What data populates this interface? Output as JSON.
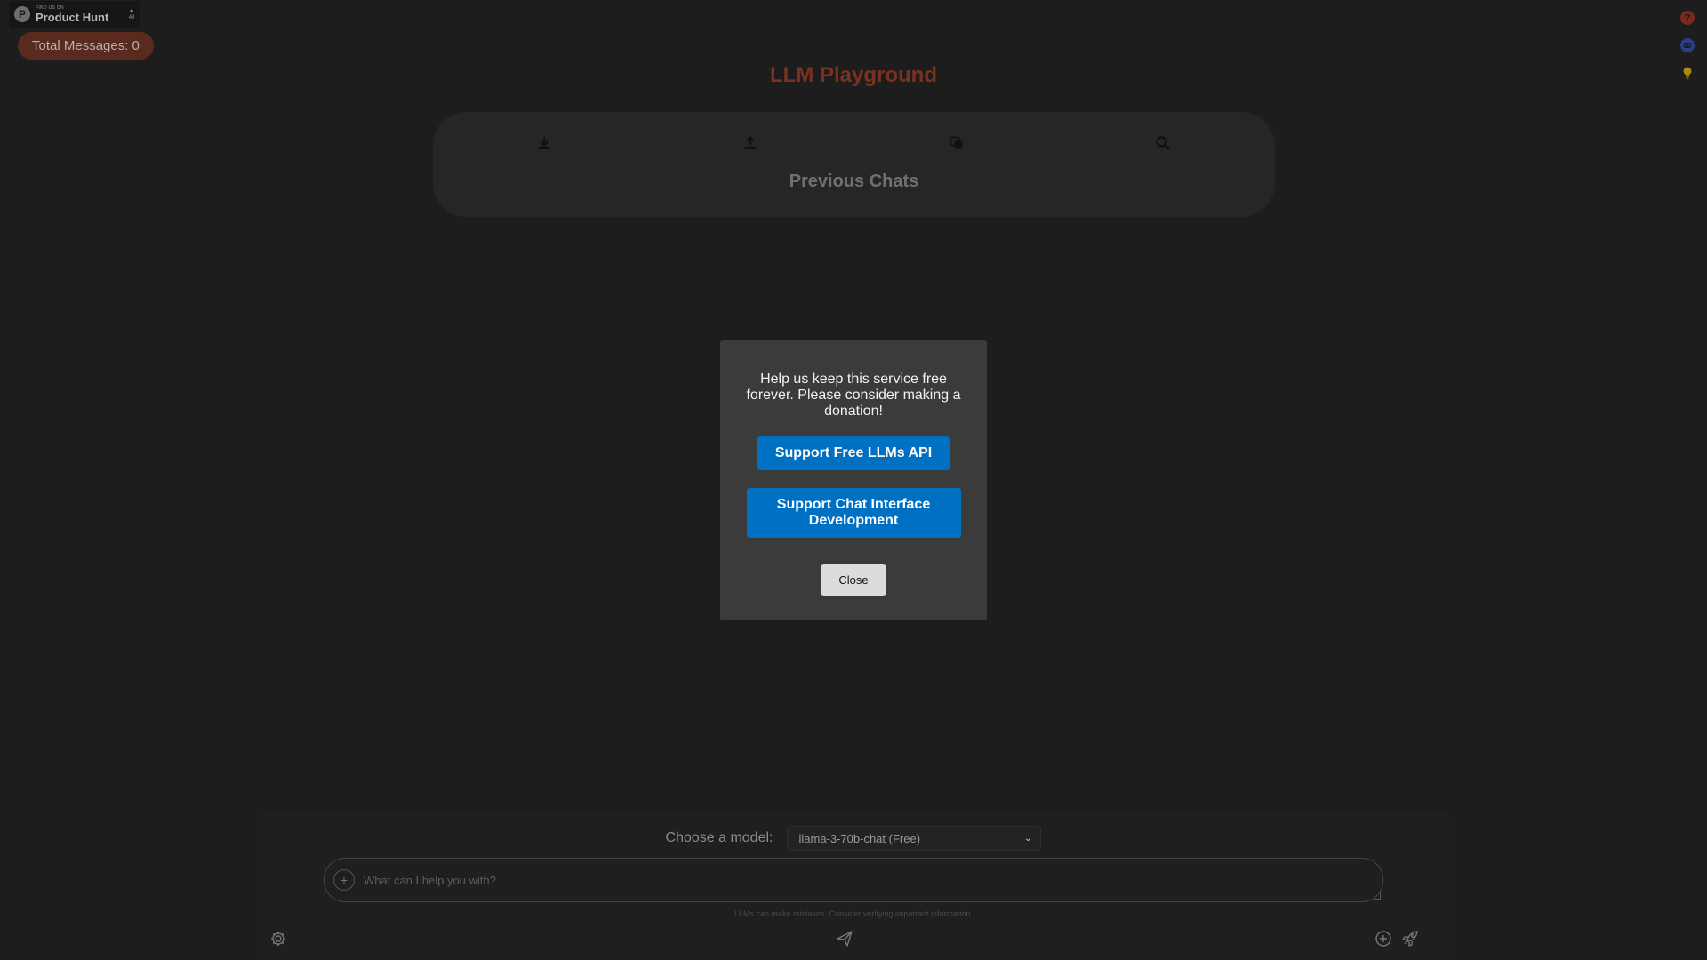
{
  "product_hunt": {
    "small_text": "Find us on",
    "name": "Product Hunt",
    "logo_letter": "P",
    "votes": "48"
  },
  "stats": {
    "total_messages": "Total Messages: 0"
  },
  "header": {
    "title": "LLM Playground"
  },
  "previous_chats": {
    "title": "Previous Chats",
    "toolbar_icons": [
      "download-icon",
      "upload-icon",
      "copy-icon",
      "search-icon"
    ]
  },
  "modal": {
    "message": "Help us keep this service free forever. Please consider making a donation!",
    "button_api": "Support Free LLMs API",
    "button_chat": "Support Chat Interface Development",
    "button_close": "Close"
  },
  "composer": {
    "model_label": "Choose a model:",
    "model_selected": "llama-3-70b-chat (Free)",
    "input_placeholder": "What can I help you with?",
    "disclaimer": "LLMs can make mistakes. Consider verifying important information."
  },
  "colors": {
    "background": "#1d1d1d",
    "title": "#7a3120",
    "button_primary": "#0071c2",
    "badge_bg": "#5a2a1f"
  }
}
